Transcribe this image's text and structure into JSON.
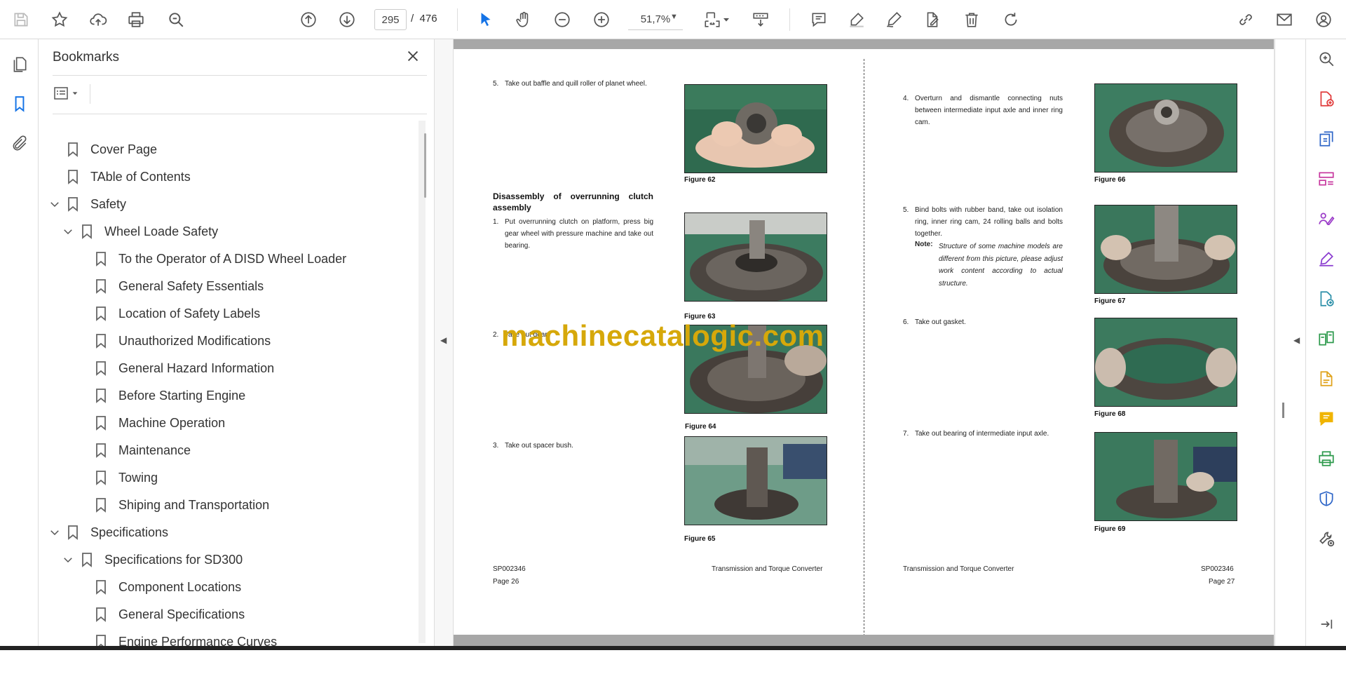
{
  "toolbar": {
    "page_current": "295",
    "page_separator": "/",
    "page_total": "476",
    "zoom": "51,7%"
  },
  "bookmarks_panel": {
    "title": "Bookmarks",
    "items": [
      {
        "label": "Cover Page",
        "level": 0,
        "expander": "none"
      },
      {
        "label": "TAble of Contents",
        "level": 0,
        "expander": "none"
      },
      {
        "label": "Safety",
        "level": 0,
        "expander": "expanded"
      },
      {
        "label": "Wheel Loade Safety",
        "level": 1,
        "expander": "expanded"
      },
      {
        "label": "To the Operator of A DISD Wheel Loader",
        "level": 2,
        "expander": "none"
      },
      {
        "label": "General Safety Essentials",
        "level": 2,
        "expander": "none"
      },
      {
        "label": "Location of Safety Labels",
        "level": 2,
        "expander": "none"
      },
      {
        "label": "Unauthorized Modifications",
        "level": 2,
        "expander": "none"
      },
      {
        "label": "General Hazard Information",
        "level": 2,
        "expander": "none"
      },
      {
        "label": "Before Starting Engine",
        "level": 2,
        "expander": "none"
      },
      {
        "label": "Machine Operation",
        "level": 2,
        "expander": "none"
      },
      {
        "label": "Maintenance",
        "level": 2,
        "expander": "none"
      },
      {
        "label": "Towing",
        "level": 2,
        "expander": "none"
      },
      {
        "label": "Shiping and Transportation",
        "level": 2,
        "expander": "none"
      },
      {
        "label": "Specifications",
        "level": 0,
        "expander": "expanded"
      },
      {
        "label": "Specifications for SD300",
        "level": 1,
        "expander": "expanded"
      },
      {
        "label": "Component Locations",
        "level": 2,
        "expander": "none"
      },
      {
        "label": "General Specifications",
        "level": 2,
        "expander": "none"
      },
      {
        "label": "Engine Performance Curves",
        "level": 2,
        "expander": "none"
      }
    ]
  },
  "document": {
    "watermark": "machinecatalogic.com",
    "left_page": {
      "step5_num": "5.",
      "step5_text": "Take out baffle and quill roller of planet wheel.",
      "section_heading": "Disassembly of overrunning clutch assembly",
      "step1_num": "1.",
      "step1_text": "Put overrunning clutch on platform, press big gear wheel with pressure machine and take out bearing.",
      "step2_num": "2.",
      "step2_text": "Take out gear.",
      "step3_num": "3.",
      "step3_text": "Take out spacer bush.",
      "fig62": "Figure 62",
      "fig63": "Figure 63",
      "fig64": "Figure 64",
      "fig65": "Figure 65",
      "footer_code": "SP002346",
      "footer_title": "Transmission and Torque Converter",
      "footer_page": "Page 26"
    },
    "right_page": {
      "step4_num": "4.",
      "step4_text": "Overturn and dismantle connecting nuts between intermediate input axle and inner ring cam.",
      "step5_num": "5.",
      "step5_text": "Bind bolts with rubber band, take out isolation ring, inner ring cam, 24 rolling balls and bolts together.",
      "note_label": "Note:",
      "note_text": "Structure of some machine models are different from this picture, please adjust work content according to actual structure.",
      "step6_num": "6.",
      "step6_text": "Take out gasket.",
      "step7_num": "7.",
      "step7_text": "Take out bearing of intermediate input axle.",
      "fig66": "Figure 66",
      "fig67": "Figure 67",
      "fig68": "Figure 68",
      "fig69": "Figure 69",
      "footer_title": "Transmission and Torque Converter",
      "footer_code": "SP002346",
      "footer_page": "Page 27"
    }
  },
  "colors": {
    "accent": "#1473e6",
    "watermark": "#d6a80a",
    "rail_icon": "#6d6d6d"
  }
}
